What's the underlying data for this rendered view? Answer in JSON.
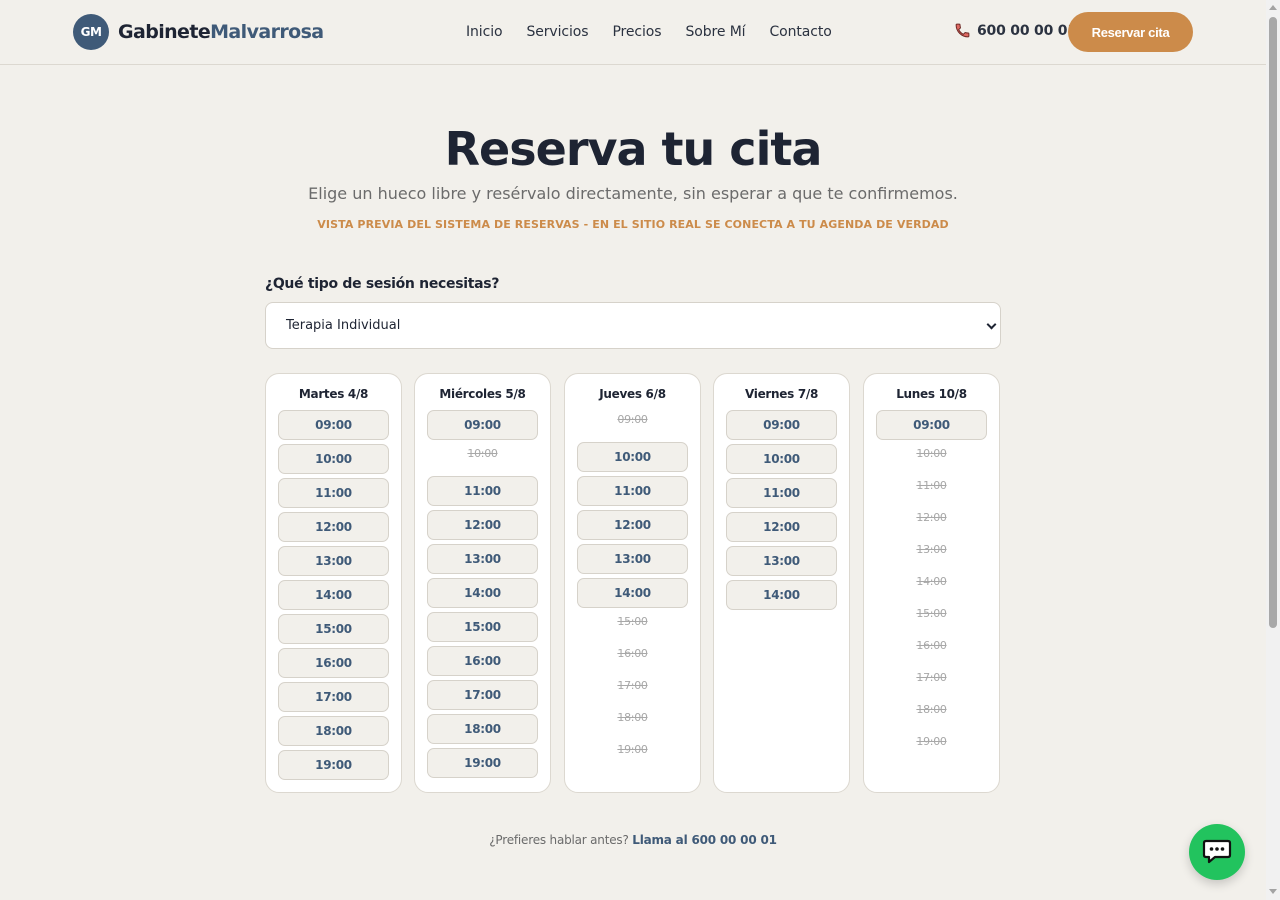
{
  "brand": {
    "initials": "GM",
    "name_part1": "Gabinete",
    "name_part2": "Malvarrosa"
  },
  "nav": {
    "items": [
      "Inicio",
      "Servicios",
      "Precios",
      "Sobre Mí",
      "Contacto"
    ]
  },
  "header": {
    "phone": "600 00 00 01",
    "cta_label": "Reservar cita",
    "cta_color": "#cc8b4a"
  },
  "hero": {
    "title": "Reserva tu cita",
    "subtitle": "Elige un hueco libre y resérvalo directamente, sin esperar a que te confirmemos.",
    "note": "VISTA PREVIA DEL SISTEMA DE RESERVAS - EN EL SITIO REAL SE CONECTA A TU AGENDA DE VERDAD"
  },
  "session": {
    "label": "¿Qué tipo de sesión necesitas?",
    "selected": "Terapia Individual"
  },
  "days": [
    {
      "title": "Martes 4/8",
      "slots": [
        {
          "time": "09:00",
          "available": true
        },
        {
          "time": "10:00",
          "available": true
        },
        {
          "time": "11:00",
          "available": true
        },
        {
          "time": "12:00",
          "available": true
        },
        {
          "time": "13:00",
          "available": true
        },
        {
          "time": "14:00",
          "available": true
        },
        {
          "time": "15:00",
          "available": true
        },
        {
          "time": "16:00",
          "available": true
        },
        {
          "time": "17:00",
          "available": true
        },
        {
          "time": "18:00",
          "available": true
        },
        {
          "time": "19:00",
          "available": true
        }
      ]
    },
    {
      "title": "Miércoles 5/8",
      "slots": [
        {
          "time": "09:00",
          "available": true
        },
        {
          "time": "10:00",
          "available": false
        },
        {
          "time": "11:00",
          "available": true
        },
        {
          "time": "12:00",
          "available": true
        },
        {
          "time": "13:00",
          "available": true
        },
        {
          "time": "14:00",
          "available": true
        },
        {
          "time": "15:00",
          "available": true
        },
        {
          "time": "16:00",
          "available": true
        },
        {
          "time": "17:00",
          "available": true
        },
        {
          "time": "18:00",
          "available": true
        },
        {
          "time": "19:00",
          "available": true
        }
      ]
    },
    {
      "title": "Jueves 6/8",
      "slots": [
        {
          "time": "09:00",
          "available": false
        },
        {
          "time": "10:00",
          "available": true
        },
        {
          "time": "11:00",
          "available": true
        },
        {
          "time": "12:00",
          "available": true
        },
        {
          "time": "13:00",
          "available": true
        },
        {
          "time": "14:00",
          "available": true
        },
        {
          "time": "15:00",
          "available": false
        },
        {
          "time": "16:00",
          "available": false
        },
        {
          "time": "17:00",
          "available": false
        },
        {
          "time": "18:00",
          "available": false
        },
        {
          "time": "19:00",
          "available": false
        }
      ]
    },
    {
      "title": "Viernes 7/8",
      "slots": [
        {
          "time": "09:00",
          "available": true
        },
        {
          "time": "10:00",
          "available": true
        },
        {
          "time": "11:00",
          "available": true
        },
        {
          "time": "12:00",
          "available": true
        },
        {
          "time": "13:00",
          "available": true
        },
        {
          "time": "14:00",
          "available": true
        }
      ]
    },
    {
      "title": "Lunes 10/8",
      "slots": [
        {
          "time": "09:00",
          "available": true
        },
        {
          "time": "10:00",
          "available": false
        },
        {
          "time": "11:00",
          "available": false
        },
        {
          "time": "12:00",
          "available": false
        },
        {
          "time": "13:00",
          "available": false
        },
        {
          "time": "14:00",
          "available": false
        },
        {
          "time": "15:00",
          "available": false
        },
        {
          "time": "16:00",
          "available": false
        },
        {
          "time": "17:00",
          "available": false
        },
        {
          "time": "18:00",
          "available": false
        },
        {
          "time": "19:00",
          "available": false
        }
      ]
    }
  ],
  "footer": {
    "call_prefix": "¿Prefieres hablar antes?",
    "call_link": "Llama al 600 00 00 01"
  },
  "icons": {
    "phone": "phone-icon",
    "chat": "chat-icon",
    "chevron": "chevron-down-icon"
  }
}
